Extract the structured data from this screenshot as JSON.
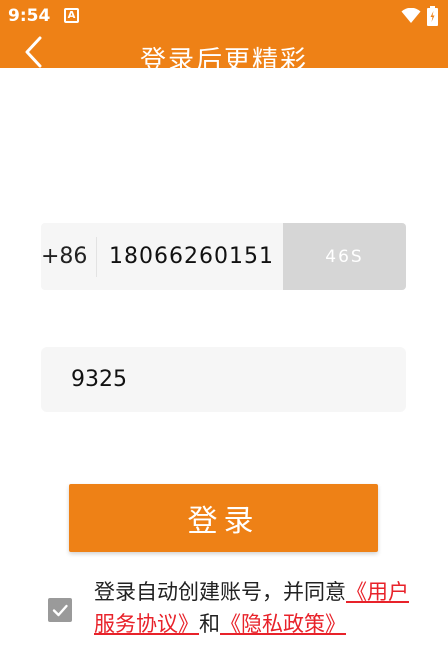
{
  "status_bar": {
    "time": "9:54",
    "app_icon_letter": "A",
    "icons": [
      "wifi-icon",
      "battery-icon"
    ]
  },
  "header": {
    "title": "登录后更精彩",
    "back_icon": "chevron-left-icon"
  },
  "phone": {
    "country_code": "+86",
    "number": "18066260151",
    "countdown_label": "46S"
  },
  "verification": {
    "code": "9325"
  },
  "login_button": {
    "label": "登录"
  },
  "agreement": {
    "checked": true,
    "check_icon": "checkmark-icon",
    "prefix": "登录自动创建账号，并同意",
    "user_agreement": "《用户服务协议》",
    "joiner": "和",
    "privacy_policy": "《隐私政策》"
  },
  "colors": {
    "accent": "#EE8116",
    "link": "#E8222A",
    "field_bg": "#F6F6F6",
    "countdown_bg": "#D6D6D6"
  }
}
